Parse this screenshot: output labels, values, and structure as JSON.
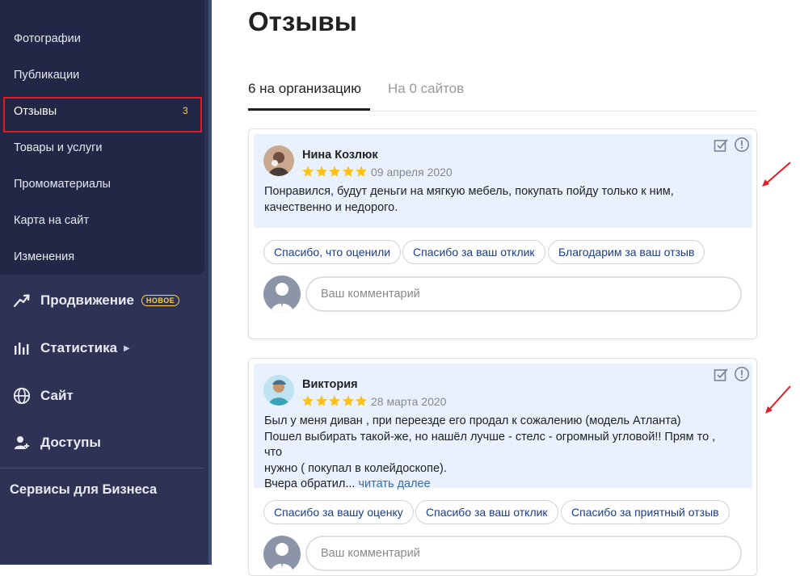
{
  "sidebar": {
    "subnav": [
      {
        "label": "Фотографии"
      },
      {
        "label": "Публикации"
      },
      {
        "label": "Отзывы",
        "badge": "3"
      },
      {
        "label": "Товары и услуги"
      },
      {
        "label": "Промоматериалы"
      },
      {
        "label": "Карта на сайт"
      },
      {
        "label": "Изменения"
      }
    ],
    "nav": [
      {
        "label": "Продвижение",
        "badge": "НОВОЕ",
        "icon": "trend-up-icon"
      },
      {
        "label": "Статистика",
        "icon": "bar-chart-icon"
      },
      {
        "label": "Сайт",
        "icon": "globe-icon"
      },
      {
        "label": "Доступы",
        "icon": "user-add-icon"
      }
    ],
    "services": "Сервисы для Бизнеса"
  },
  "page": {
    "title": "Отзывы"
  },
  "tabs": [
    {
      "label": "6 на организацию",
      "active": true
    },
    {
      "label": "На 0 сайтов",
      "active": false
    }
  ],
  "reviews": [
    {
      "author": "Нина Козлюк",
      "rating": 5,
      "date": "09 апреля 2020",
      "text": [
        "Понравился, будут деньги на мягкую мебель, покупать пойду только к ним,",
        "качественно и недорого."
      ],
      "replies": [
        "Спасибо, что оценили",
        "Спасибо за ваш отклик",
        "Благодарим за ваш отзыв"
      ],
      "comment_placeholder": "Ваш комментарий"
    },
    {
      "author": "Виктория",
      "rating": 5,
      "date": "28 марта 2020",
      "text": [
        "Был у меня диван , при переезде его продал к сожалению (модель Атланта)",
        "Пошел выбирать такой-же, но нашёл лучше - стелс - огромный угловой!! Прям то , что",
        "нужно ( покупал в колейдоскопе).",
        "Вчера обратил..."
      ],
      "read_more": "читать далее",
      "replies": [
        "Спасибо за вашу оценку",
        "Спасибо за ваш отклик",
        "Спасибо за приятный отзыв"
      ],
      "comment_placeholder": "Ваш комментарий"
    }
  ],
  "colors": {
    "sidebar_bg": "#2e3356",
    "subnav_bg": "#232746",
    "highlight": "#e21b24",
    "accent_yellow": "#ffd23c",
    "review_bg": "#e8f1fd",
    "link": "#1c3c8a"
  }
}
